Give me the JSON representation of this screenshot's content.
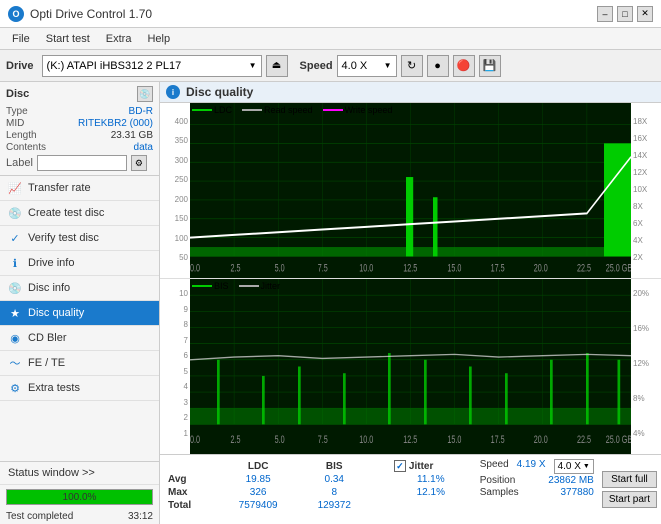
{
  "app": {
    "title": "Opti Drive Control 1.70",
    "icon": "O"
  },
  "title_controls": {
    "minimize": "–",
    "maximize": "□",
    "close": "✕"
  },
  "menu": {
    "items": [
      "File",
      "Start test",
      "Extra",
      "Help"
    ]
  },
  "drive_bar": {
    "drive_label": "Drive",
    "drive_value": "(K:)  ATAPI iHBS312  2 PL17",
    "speed_label": "Speed",
    "speed_value": "4.0 X"
  },
  "disc": {
    "label": "Disc",
    "type_label": "Type",
    "type_value": "BD-R",
    "mid_label": "MID",
    "mid_value": "RITEKBR2 (000)",
    "length_label": "Length",
    "length_value": "23.31 GB",
    "contents_label": "Contents",
    "contents_value": "data",
    "label_label": "Label",
    "label_value": ""
  },
  "nav": {
    "items": [
      {
        "id": "transfer-rate",
        "label": "Transfer rate",
        "icon": "📈"
      },
      {
        "id": "create-test-disc",
        "label": "Create test disc",
        "icon": "💿"
      },
      {
        "id": "verify-test-disc",
        "label": "Verify test disc",
        "icon": "✓"
      },
      {
        "id": "drive-info",
        "label": "Drive info",
        "icon": "ℹ"
      },
      {
        "id": "disc-info",
        "label": "Disc info",
        "icon": "💿"
      },
      {
        "id": "disc-quality",
        "label": "Disc quality",
        "icon": "★",
        "active": true
      },
      {
        "id": "cd-bler",
        "label": "CD Bler",
        "icon": "◉"
      },
      {
        "id": "fe-te",
        "label": "FE / TE",
        "icon": "〜"
      },
      {
        "id": "extra-tests",
        "label": "Extra tests",
        "icon": "⚙"
      }
    ]
  },
  "status": {
    "window_label": "Status window >>",
    "progress_percent": 100,
    "completed_label": "Test completed",
    "time": "33:12"
  },
  "chart": {
    "title": "Disc quality",
    "header_icon": "i",
    "legend_top": {
      "ldc": {
        "label": "LDC",
        "color": "#00cc00"
      },
      "read_speed": {
        "label": "Read speed",
        "color": "#ffffff"
      },
      "write_speed": {
        "label": "Write speed",
        "color": "#ff00ff"
      }
    },
    "legend_bottom": {
      "bis": {
        "label": "BIS",
        "color": "#00cc00"
      },
      "jitter": {
        "label": "Jitter",
        "color": "#ffffff"
      }
    },
    "top_y_left": [
      "400",
      "350",
      "300",
      "250",
      "200",
      "150",
      "100",
      "50"
    ],
    "top_y_right": [
      "18X",
      "16X",
      "14X",
      "12X",
      "10X",
      "8X",
      "6X",
      "4X",
      "2X"
    ],
    "top_x": [
      "0.0",
      "2.5",
      "5.0",
      "7.5",
      "10.0",
      "12.5",
      "15.0",
      "17.5",
      "20.0",
      "22.5",
      "25.0 GB"
    ],
    "bottom_y_left": [
      "10",
      "9",
      "8",
      "7",
      "6",
      "5",
      "4",
      "3",
      "2",
      "1"
    ],
    "bottom_y_right": [
      "20%",
      "16%",
      "12%",
      "8%",
      "4%"
    ],
    "bottom_x": [
      "0.0",
      "2.5",
      "5.0",
      "7.5",
      "10.0",
      "12.5",
      "15.0",
      "17.5",
      "20.0",
      "22.5",
      "25.0 GB"
    ]
  },
  "stats": {
    "columns": [
      "",
      "LDC",
      "BIS",
      "",
      "Jitter",
      "Speed",
      ""
    ],
    "avg_label": "Avg",
    "max_label": "Max",
    "total_label": "Total",
    "avg_ldc": "19.85",
    "avg_bis": "0.34",
    "avg_jitter": "11.1%",
    "max_ldc": "326",
    "max_bis": "8",
    "max_jitter": "12.1%",
    "total_ldc": "7579409",
    "total_bis": "129372",
    "speed_label": "Speed",
    "speed_value": "4.19 X",
    "speed_select": "4.0 X",
    "position_label": "Position",
    "position_value": "23862 MB",
    "samples_label": "Samples",
    "samples_value": "377880",
    "jitter_checked": true,
    "jitter_label": "Jitter",
    "btn_start_full": "Start full",
    "btn_start_part": "Start part"
  }
}
